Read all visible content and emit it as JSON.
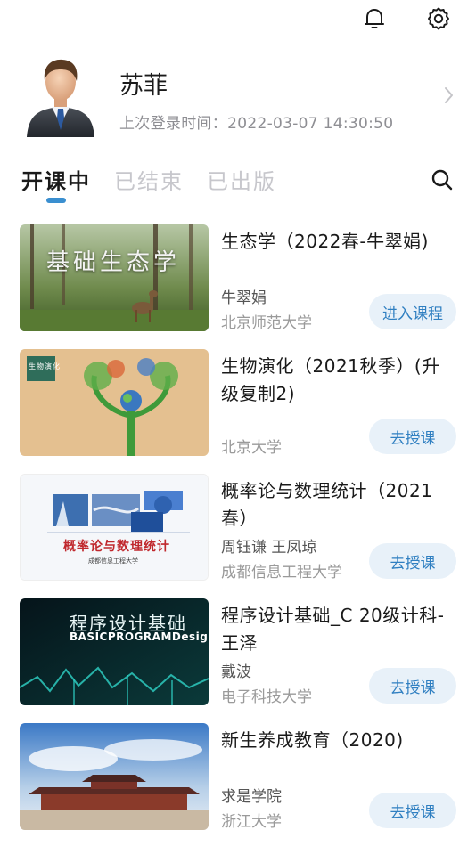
{
  "header": {
    "bell_icon": "bell-icon",
    "settings_icon": "gear-icon"
  },
  "profile": {
    "name": "苏菲",
    "last_login": "上次登录时间：2022-03-07 14:30:50"
  },
  "tabs": [
    {
      "label": "开课中",
      "active": true
    },
    {
      "label": "已结束",
      "active": false
    },
    {
      "label": "已出版",
      "active": false
    }
  ],
  "courses": [
    {
      "title": "生态学（2022春-牛翠娟)",
      "teacher": "牛翠娟",
      "school": "北京师范大学",
      "action": "进入课程",
      "thumb_text": "基础生态学"
    },
    {
      "title": "生物演化（2021秋季）(升级复制2)",
      "teacher": "",
      "school": "北京大学",
      "action": "去授课",
      "thumb_text": "生物演化"
    },
    {
      "title": "概率论与数理统计（2021春）",
      "teacher": "周钰谦 王凤琼",
      "school": "成都信息工程大学",
      "action": "去授课",
      "thumb_text": "概率论与数理统计",
      "thumb_sub": "成都信息工程大学"
    },
    {
      "title": "程序设计基础_C 20级计科-王泽",
      "teacher": "戴波",
      "school": "电子科技大学",
      "action": "去授课",
      "thumb_text": "程序设计基础",
      "thumb_sub": "BASICPROGRAMDesign"
    },
    {
      "title": "新生养成教育（2020)",
      "teacher": "求是学院",
      "school": "浙江大学",
      "action": "去授课",
      "thumb_text": ""
    }
  ],
  "colors": {
    "accent": "#3a8fd0",
    "button_bg": "#e8f1f9",
    "button_text": "#2f7fc1"
  }
}
